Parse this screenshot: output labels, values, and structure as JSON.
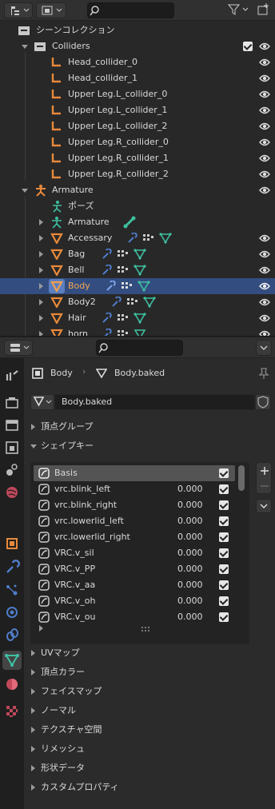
{
  "outliner": {
    "search_placeholder": "",
    "rows": [
      {
        "label": "シーンコレクション",
        "type": "scene"
      },
      {
        "label": "Colliders",
        "type": "collection",
        "checked": true
      },
      {
        "label": "Head_collider_0",
        "type": "bone"
      },
      {
        "label": "Head_collider_1",
        "type": "bone"
      },
      {
        "label": "Upper Leg.L_collider_0",
        "type": "bone"
      },
      {
        "label": "Upper Leg.L_collider_1",
        "type": "bone"
      },
      {
        "label": "Upper Leg.L_collider_2",
        "type": "bone"
      },
      {
        "label": "Upper Leg.R_collider_0",
        "type": "bone"
      },
      {
        "label": "Upper Leg.R_collider_1",
        "type": "bone"
      },
      {
        "label": "Upper Leg.R_collider_2",
        "type": "bone"
      },
      {
        "label": "Armature",
        "type": "armature"
      },
      {
        "label": "ポーズ",
        "type": "pose"
      },
      {
        "label": "Armature",
        "type": "armature-data"
      },
      {
        "label": "Accessary",
        "type": "mesh"
      },
      {
        "label": "Bag",
        "type": "mesh"
      },
      {
        "label": "Bell",
        "type": "mesh"
      },
      {
        "label": "Body",
        "type": "mesh",
        "selected": true
      },
      {
        "label": "Body2",
        "type": "mesh"
      },
      {
        "label": "Hair",
        "type": "mesh"
      },
      {
        "label": "horn",
        "type": "mesh"
      }
    ]
  },
  "properties": {
    "breadcrumb": {
      "object": "Body",
      "mesh": "Body.baked"
    },
    "mesh_name": "Body.baked",
    "sections_top": [
      "頂点グループ",
      "シェイプキー"
    ],
    "shape_keys": [
      {
        "name": "Basis",
        "value": ""
      },
      {
        "name": "vrc.blink_left",
        "value": "0.000"
      },
      {
        "name": "vrc.blink_right",
        "value": "0.000"
      },
      {
        "name": "vrc.lowerlid_left",
        "value": "0.000"
      },
      {
        "name": "vrc.lowerlid_right",
        "value": "0.000"
      },
      {
        "name": "VRC.v_sil",
        "value": "0.000"
      },
      {
        "name": "VRC.v_PP",
        "value": "0.000"
      },
      {
        "name": "VRC.v_aa",
        "value": "0.000"
      },
      {
        "name": "VRC.v_oh",
        "value": "0.000"
      },
      {
        "name": "VRC.v_ou",
        "value": "0.000"
      }
    ],
    "sections_bottom": [
      "UVマップ",
      "頂点カラー",
      "フェイスマップ",
      "ノーマル",
      "テクスチャ空間",
      "リメッシュ",
      "形状データ",
      "カスタムプロパティ"
    ]
  },
  "colors": {
    "selected_row": "#334d80",
    "bone_orange": "#e8893a",
    "mesh_green": "#3ec0a0",
    "accent_blue": "#4f7cc7"
  }
}
